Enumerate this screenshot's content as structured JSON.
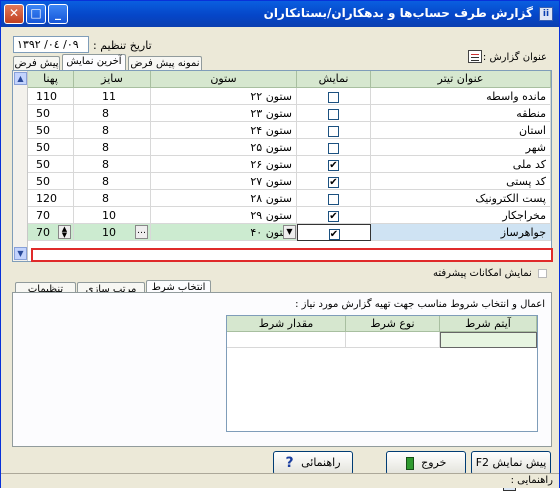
{
  "window": {
    "title": "گزارش طرف حساب‌ها و بدهکاران/بستانکاران",
    "app_icon": "ii"
  },
  "header": {
    "date_label": "تاریخ تنظیم :",
    "date_value": "۱۳۹۲ /۰٤ /۰۹",
    "report_title_label": "عنوان گزارش :"
  },
  "tabs": {
    "preview": "پیش فرض",
    "last": "آخرین نمایش",
    "sample": "نمونه پیش فرض"
  },
  "grid": {
    "headers": {
      "title": "عنوان تیتر",
      "show": "نمایش",
      "column": "ستون",
      "size": "سایز",
      "width": "پهنا"
    },
    "rows": [
      {
        "title": "مانده واسطه",
        "show": false,
        "column": "ستون ۲۲",
        "size": "11",
        "width": "110"
      },
      {
        "title": "منطقه",
        "show": false,
        "column": "ستون ۲۳",
        "size": "8",
        "width": "50"
      },
      {
        "title": "استان",
        "show": false,
        "column": "ستون ۲۴",
        "size": "8",
        "width": "50"
      },
      {
        "title": "شهر",
        "show": false,
        "column": "ستون ۲۵",
        "size": "8",
        "width": "50"
      },
      {
        "title": "کد ملی",
        "show": true,
        "column": "ستون ۲۶",
        "size": "8",
        "width": "50"
      },
      {
        "title": "کد پستی",
        "show": true,
        "column": "ستون ۲۷",
        "size": "8",
        "width": "50"
      },
      {
        "title": "پست الکترونیک",
        "show": false,
        "column": "ستون ۲۸",
        "size": "8",
        "width": "120"
      },
      {
        "title": "مخراجکار",
        "show": true,
        "column": "ستون ۲۹",
        "size": "10",
        "width": "70"
      },
      {
        "title": "جواهرساز",
        "show": true,
        "column": "ستون ۴۰",
        "size": "10",
        "width": "70"
      }
    ]
  },
  "advanced": {
    "label": "نمایش امکانات پیشرفته"
  },
  "lower_tabs": {
    "select": "انتخاب شرط",
    "sort": "مرتب سازی",
    "settings": "تنظیمات"
  },
  "conditions": {
    "instruction": "اعمال و انتخاب شروط مناسب جهت تهیه گزارش مورد نیاز :",
    "headers": {
      "item": "آیتم شرط",
      "type": "نوع شرط",
      "value": "مقدار شرط"
    }
  },
  "buttons": {
    "preview": "پیش نمایش F2",
    "exit": "خروج",
    "help": "راهنمائی"
  },
  "status": {
    "text": "راهنمایی :"
  },
  "colors": {
    "titlebar": "#0546c8",
    "header_bg": "#d6e7cf",
    "selection_border": "#e02a2a",
    "selected_row": "#ccebd0"
  }
}
